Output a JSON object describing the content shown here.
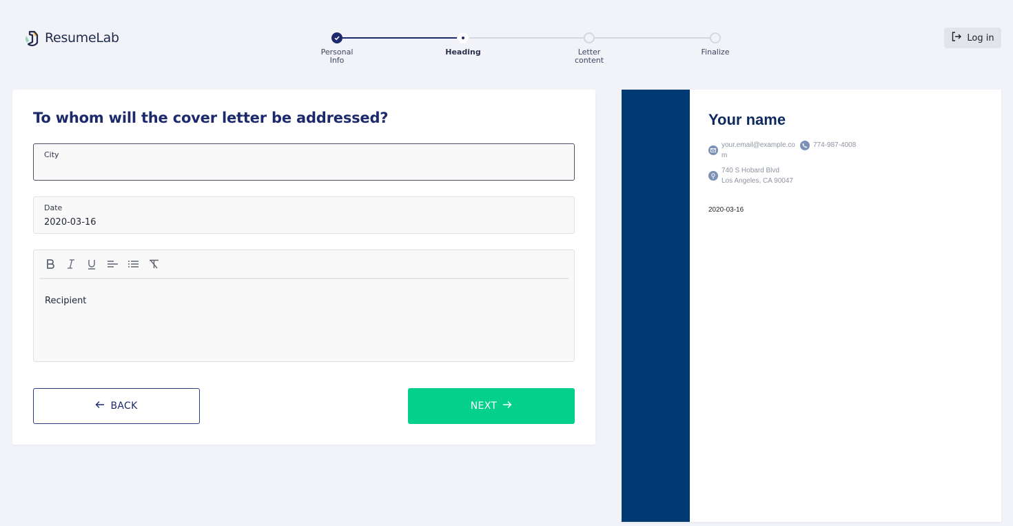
{
  "header": {
    "brand": "ResumeLab",
    "login_label": "Log in",
    "steps": [
      {
        "label_line1": "Personal",
        "label_line2": "Info",
        "state": "done"
      },
      {
        "label_line1": "Heading",
        "label_line2": "",
        "state": "current"
      },
      {
        "label_line1": "Letter",
        "label_line2": "content",
        "state": "todo"
      },
      {
        "label_line1": "Finalize",
        "label_line2": "",
        "state": "todo"
      }
    ]
  },
  "form": {
    "title": "To whom will the cover letter be addressed?",
    "city": {
      "label": "City",
      "value": ""
    },
    "date": {
      "label": "Date",
      "value": "2020-03-16"
    },
    "editor": {
      "toolbar": [
        "bold-icon",
        "italic-icon",
        "underline-icon",
        "align-left-icon",
        "bulleted-list-icon",
        "clear-format-icon"
      ],
      "placeholder": "Recipient"
    },
    "back_label": "BACK",
    "next_label": "NEXT"
  },
  "preview": {
    "name": "Your name",
    "email_line1": "your.email@example.co",
    "email_line2": "m",
    "phone": "774-987-4008",
    "address_line1": "740 S Hobard Blvd",
    "address_line2": "Los Angeles, CA 90047",
    "date": "2020-03-16",
    "sidebar_color": "#003a73"
  },
  "colors": {
    "brand_navy": "#1c2a6b",
    "next_green": "#05d08c",
    "background": "#f2f3f8"
  }
}
